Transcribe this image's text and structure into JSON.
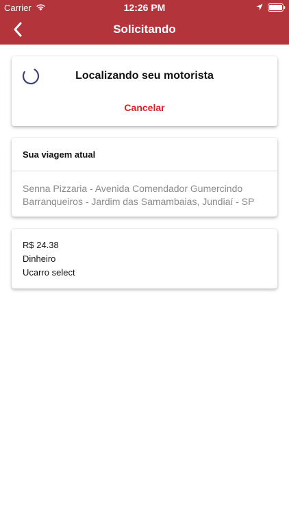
{
  "status_bar": {
    "carrier": "Carrier",
    "time": "12:26 PM",
    "icons": [
      "wifi-icon",
      "location-arrow-icon",
      "battery-icon"
    ]
  },
  "nav": {
    "title": "Solicitando",
    "back_icon": "chevron-left-icon"
  },
  "request_status": {
    "message": "Localizando seu motorista",
    "cancel_label": "Cancelar",
    "spinner_icon": "loading-spinner-icon"
  },
  "current_trip": {
    "header": "Sua viagem atual",
    "address_line1": "Senna Pizzaria - Avenida Comendador Gumercindo",
    "address_line2": "Barranqueiros - Jardim das Samambaias, Jundiaí - SP"
  },
  "payment": {
    "price": "R$ 24.38",
    "method": "Dinheiro",
    "category": "Ucarro select"
  },
  "colors": {
    "header_bg": "#b3353b",
    "cancel": "#e02020",
    "spinner": "#3b3f7a",
    "address_text": "#8a8a8a"
  }
}
